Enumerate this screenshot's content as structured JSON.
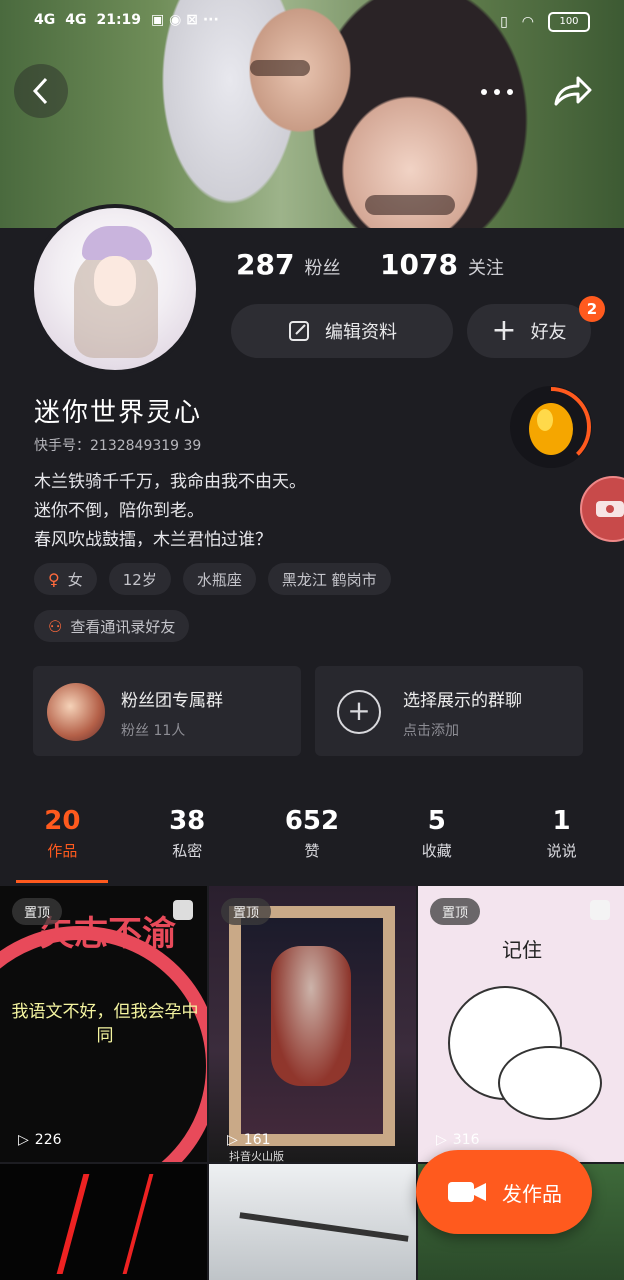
{
  "status_bar": {
    "signal1": "4G",
    "signal2": "4G",
    "time": "21:19",
    "battery": "100"
  },
  "profile": {
    "fans_count": "287",
    "fans_label": "粉丝",
    "following_count": "1078",
    "following_label": "关注",
    "edit_label": "编辑资料",
    "add_friend_label": "好友",
    "friend_badge": "2",
    "name": "迷你世界灵心",
    "kuaishou_id": "快手号：2132849319 39",
    "bio": [
      "木兰铁骑千千万，我命由我不由天。",
      "迷你不倒，陪你到老。",
      "春风吹战鼓擂，木兰君怕过谁？"
    ],
    "tags": {
      "gender": "女",
      "age": "12岁",
      "zodiac": "水瓶座",
      "location": "黑龙江 鹤岗市"
    },
    "contacts_label": "查看通讯录好友"
  },
  "groups": {
    "fan_group_title": "粉丝团专属群",
    "fan_group_sub": "粉丝 11人",
    "choose_title": "选择展示的群聊",
    "choose_sub": "点击添加"
  },
  "tabs": [
    {
      "num": "20",
      "label": "作品"
    },
    {
      "num": "38",
      "label": "私密"
    },
    {
      "num": "652",
      "label": "赞"
    },
    {
      "num": "5",
      "label": "收藏"
    },
    {
      "num": "1",
      "label": "说说"
    }
  ],
  "grid": [
    {
      "pin": "置顶",
      "plays": "226",
      "overlay_text": "我语文不好，但我会孕中同",
      "banner": "矢志不渝"
    },
    {
      "pin": "置顶",
      "plays": "161",
      "watermark": "抖音火山版"
    },
    {
      "pin": "置顶",
      "plays": "316",
      "overlay_text": "记住"
    }
  ],
  "fab": {
    "label": "发作品"
  },
  "colors": {
    "accent": "#ff5a1e",
    "bg": "#1d1d22",
    "card": "#28282e"
  }
}
